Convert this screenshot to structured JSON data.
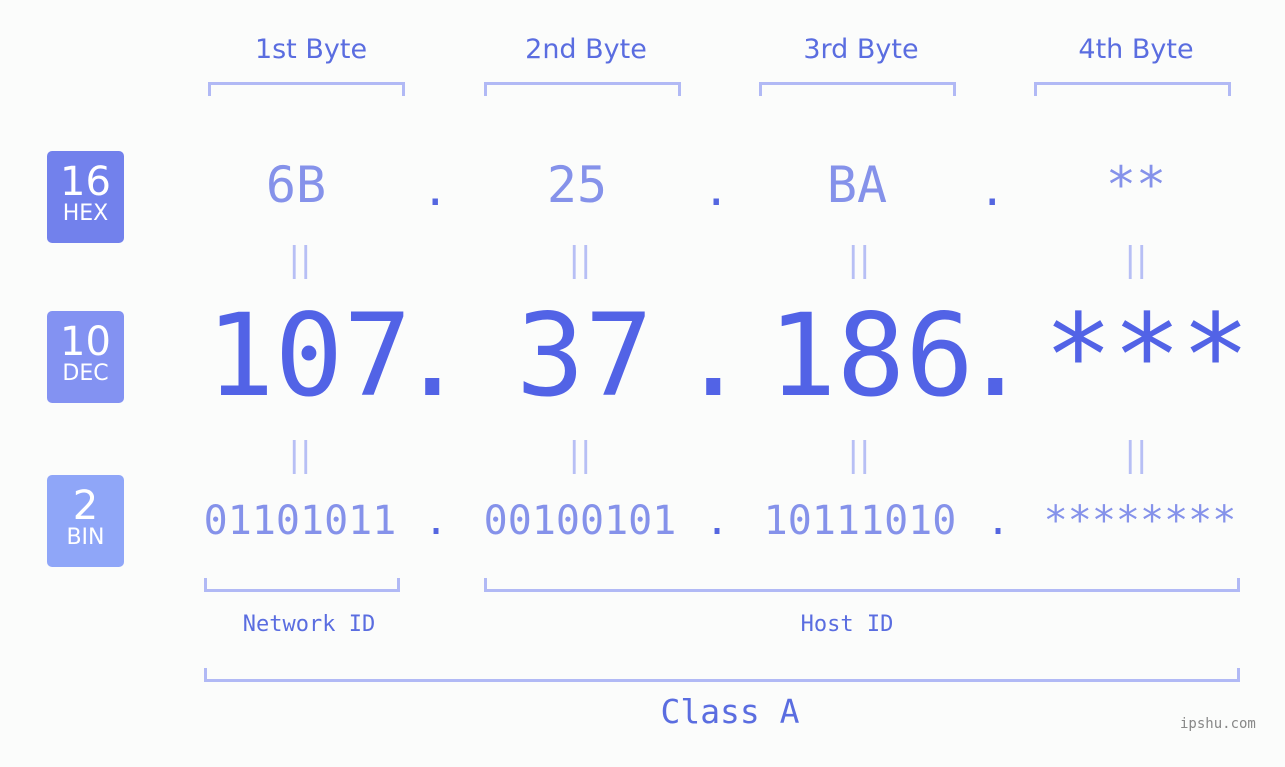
{
  "bytes": {
    "headers": [
      "1st Byte",
      "2nd Byte",
      "3rd Byte",
      "4th Byte"
    ],
    "hex": [
      "6B",
      "25",
      "BA",
      "**"
    ],
    "dec": [
      "107",
      "37",
      "186",
      "***"
    ],
    "bin": [
      "01101011",
      "00100101",
      "10111010",
      "********"
    ]
  },
  "separator": ".",
  "equals": "||",
  "badges": {
    "hex": {
      "num": "16",
      "label": "HEX",
      "color": "#7281ec"
    },
    "dec": {
      "num": "10",
      "label": "DEC",
      "color": "#8392f2"
    },
    "bin": {
      "num": "2",
      "label": "BIN",
      "color": "#8fa6f8"
    }
  },
  "labels": {
    "network_id": "Network ID",
    "host_id": "Host ID",
    "class": "Class A"
  },
  "watermark": "ipshu.com"
}
